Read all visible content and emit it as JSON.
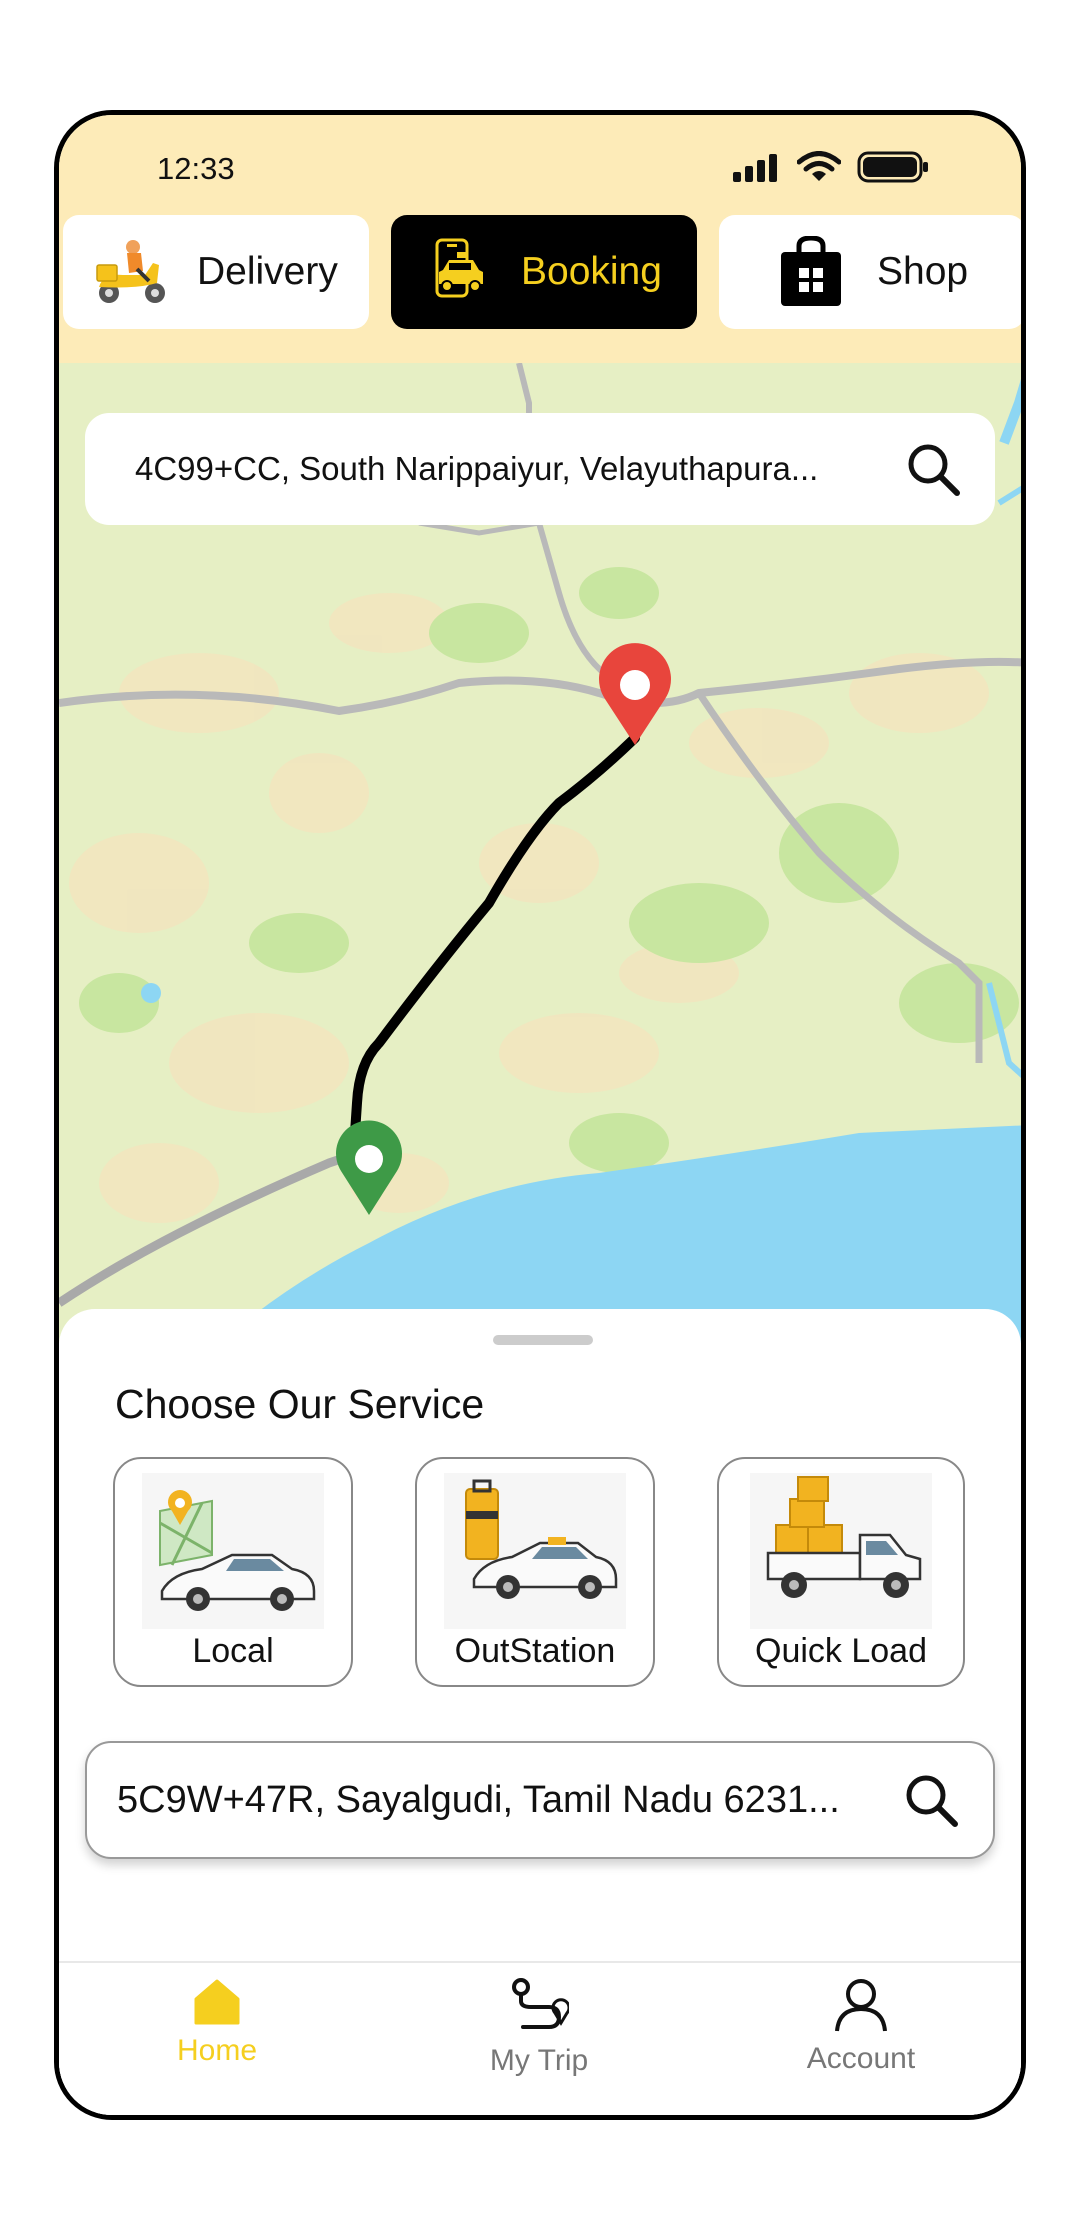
{
  "status_bar": {
    "time": "12:33"
  },
  "service_tabs": [
    {
      "label": "Delivery",
      "icon": "scooter-delivery-icon",
      "active": false
    },
    {
      "label": "Booking",
      "icon": "taxi-phone-icon",
      "active": true
    },
    {
      "label": "Shop",
      "icon": "shopping-bag-icon",
      "active": false
    }
  ],
  "map": {
    "search_address": "4C99+CC, South Narippaiyur, Velayuthapura...",
    "pickup_marker": "green-pin",
    "drop_marker": "red-pin"
  },
  "sheet": {
    "title": "Choose Our Service",
    "services": [
      {
        "label": "Local",
        "icon": "local-car-map-icon"
      },
      {
        "label": "OutStation",
        "icon": "outstation-car-luggage-icon"
      },
      {
        "label": "Quick Load",
        "icon": "pickup-truck-boxes-icon"
      }
    ],
    "address": "5C9W+47R, Sayalgudi, Tamil Nadu 6231..."
  },
  "bottom_nav": [
    {
      "label": "Home",
      "icon": "home-icon",
      "active": true
    },
    {
      "label": "My Trip",
      "icon": "route-icon",
      "active": false
    },
    {
      "label": "Account",
      "icon": "person-icon",
      "active": false
    }
  ],
  "colors": {
    "accent_yellow": "#f5cf1f",
    "top_band": "#fdebb8",
    "sea": "#8dd6f3",
    "land": "#e6efc4",
    "route": "#000000",
    "pin_red": "#e8453c",
    "pin_green": "#3e9a47"
  }
}
